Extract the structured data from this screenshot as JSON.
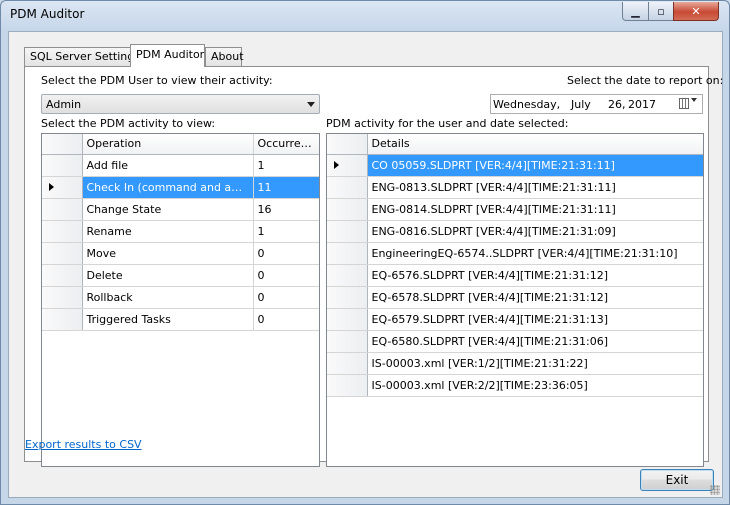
{
  "window": {
    "title": "PDM Auditor",
    "min_glyph": "▁",
    "max_glyph": "▫",
    "close_glyph": "✕"
  },
  "tabs": [
    {
      "label": "SQL Server Settings",
      "active": false
    },
    {
      "label": "PDM Auditor",
      "active": true
    },
    {
      "label": "About",
      "active": false
    }
  ],
  "user_select": {
    "label": "Select the PDM User to view their activity:",
    "value": "Admin"
  },
  "date_picker": {
    "label": "Select the date to report on:",
    "weekday": "Wednesday,",
    "month": "July",
    "day": "26,",
    "year": "2017"
  },
  "activity_grid": {
    "label": "Select the PDM activity to view:",
    "columns": [
      "Operation",
      "Occurrence"
    ],
    "rows": [
      {
        "operation": "Add file",
        "occurrence": "1"
      },
      {
        "operation": "Check In (command and automa...",
        "occurrence": "11",
        "selected": true
      },
      {
        "operation": "Change State",
        "occurrence": "16"
      },
      {
        "operation": "Rename",
        "occurrence": "1"
      },
      {
        "operation": "Move",
        "occurrence": "0"
      },
      {
        "operation": "Delete",
        "occurrence": "0"
      },
      {
        "operation": "Rollback",
        "occurrence": "0"
      },
      {
        "operation": "Triggered Tasks",
        "occurrence": "0"
      }
    ]
  },
  "details_grid": {
    "label": "PDM activity for the user and date selected:",
    "columns": [
      "Details"
    ],
    "rows": [
      {
        "details": "CO 05059.SLDPRT [VER:4/4][TIME:21:31:11]",
        "selected": true
      },
      {
        "details": "ENG-0813.SLDPRT [VER:4/4][TIME:21:31:11]"
      },
      {
        "details": "ENG-0814.SLDPRT [VER:4/4][TIME:21:31:11]"
      },
      {
        "details": "ENG-0816.SLDPRT [VER:4/4][TIME:21:31:09]"
      },
      {
        "details": "EngineeringEQ-6574..SLDPRT [VER:4/4][TIME:21:31:10]"
      },
      {
        "details": "EQ-6576.SLDPRT [VER:4/4][TIME:21:31:12]"
      },
      {
        "details": "EQ-6578.SLDPRT [VER:4/4][TIME:21:31:12]"
      },
      {
        "details": "EQ-6579.SLDPRT [VER:4/4][TIME:21:31:13]"
      },
      {
        "details": "EQ-6580.SLDPRT [VER:4/4][TIME:21:31:06]"
      },
      {
        "details": "IS-00003.xml [VER:1/2][TIME:21:31:22]"
      },
      {
        "details": "IS-00003.xml [VER:2/2][TIME:23:36:05]"
      }
    ]
  },
  "export_link": "Export results to CSV",
  "exit_button": "Exit",
  "colors": {
    "selection": "#3399ff",
    "link": "#0066cc",
    "close_button": "#c74a35"
  }
}
